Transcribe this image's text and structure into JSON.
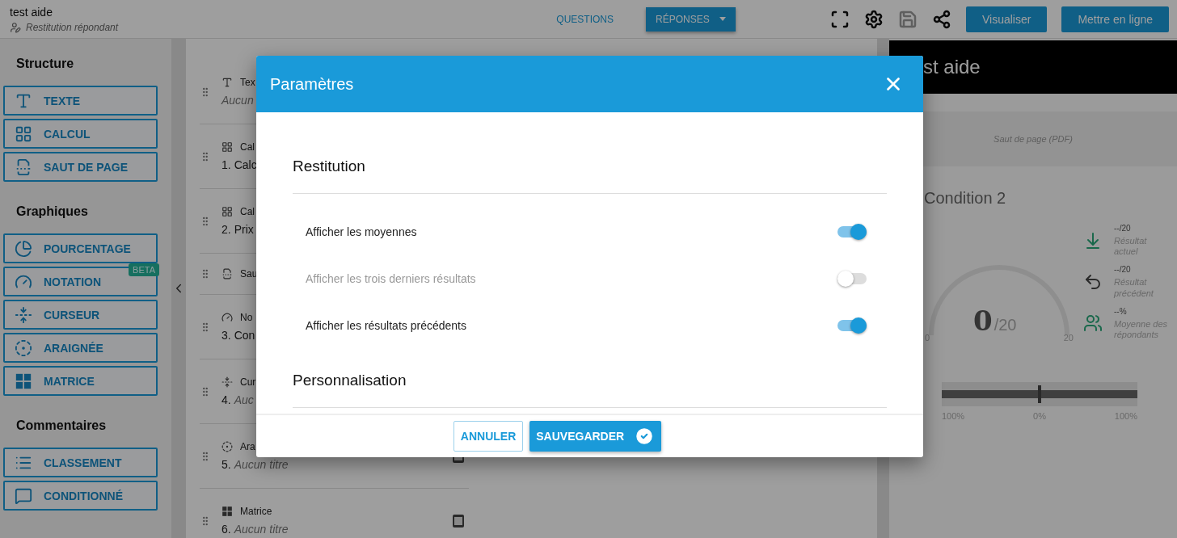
{
  "header": {
    "title": "test aide",
    "subtitle": "Restitution répondant",
    "tabs": [
      {
        "label": "QUESTIONS",
        "selected": false
      },
      {
        "label": "RÉPONSES",
        "selected": true
      }
    ],
    "save_disabled": true,
    "buttons": [
      "Visualiser",
      "Mettre en ligne"
    ]
  },
  "sidebar": {
    "sections": [
      {
        "title": "Structure",
        "items": [
          {
            "label": "TEXTE"
          },
          {
            "label": "CALCUL"
          },
          {
            "label": "SAUT DE PAGE"
          }
        ]
      },
      {
        "title": "Graphiques",
        "items": [
          {
            "label": "POURCENTAGE"
          },
          {
            "label": "NOTATION",
            "badge": "BETA"
          },
          {
            "label": "CURSEUR"
          },
          {
            "label": "ARAIGNÉE"
          },
          {
            "label": "MATRICE"
          }
        ]
      },
      {
        "title": "Commentaires",
        "items": [
          {
            "label": "CLASSEMENT"
          },
          {
            "label": "CONDITIONNÉ"
          }
        ]
      }
    ]
  },
  "elements": [
    {
      "type_label": "Tex",
      "title": "Aucun",
      "untitled": true
    },
    {
      "type_label": "Cal",
      "number": "1.",
      "title": "Calc",
      "untitled": false
    },
    {
      "type_label": "Cal",
      "number": "2.",
      "title": "Prix",
      "untitled": false
    },
    {
      "type_label": "Sau"
    },
    {
      "type_label": "No",
      "number": "3.",
      "title": "Con",
      "untitled": false
    },
    {
      "type_label": "Cur",
      "number": "4.",
      "title": "Auc",
      "untitled": true
    },
    {
      "type_label": "Ara",
      "number": "5.",
      "title": "Aucun titre",
      "untitled": true,
      "mobile": true
    },
    {
      "type_label": "Matrice",
      "number": "6.",
      "title": "Aucun titre",
      "untitled": true,
      "mobile": true
    }
  ],
  "preview": {
    "title": "st aide",
    "page_break": "Saut de page (PDF)",
    "condition": "Condition 2",
    "gauge": {
      "value": "0",
      "max": "/20",
      "min_label": "0",
      "max_label": "20"
    },
    "stats": [
      {
        "value": "--/20",
        "label": "Résultat actuel"
      },
      {
        "value": "--/20",
        "label": "Résultat précédent"
      },
      {
        "value": "--%",
        "label": "Moyenne des répondants"
      }
    ],
    "scale": [
      "100%",
      "0%",
      "100%"
    ]
  },
  "dialog": {
    "title": "Paramètres",
    "sections": [
      {
        "title": "Restitution",
        "rows": [
          {
            "label": "Afficher les moyennes",
            "on": true,
            "disabled": false
          },
          {
            "label": "Afficher les trois derniers résultats",
            "on": false,
            "disabled": true
          },
          {
            "label": "Afficher les résultats précédents",
            "on": true,
            "disabled": false
          }
        ]
      },
      {
        "title": "Personnalisation"
      }
    ],
    "buttons": [
      {
        "label": "ANNULER",
        "kind": "secondary"
      },
      {
        "label": "SAUVEGARDER",
        "kind": "primary"
      }
    ]
  }
}
